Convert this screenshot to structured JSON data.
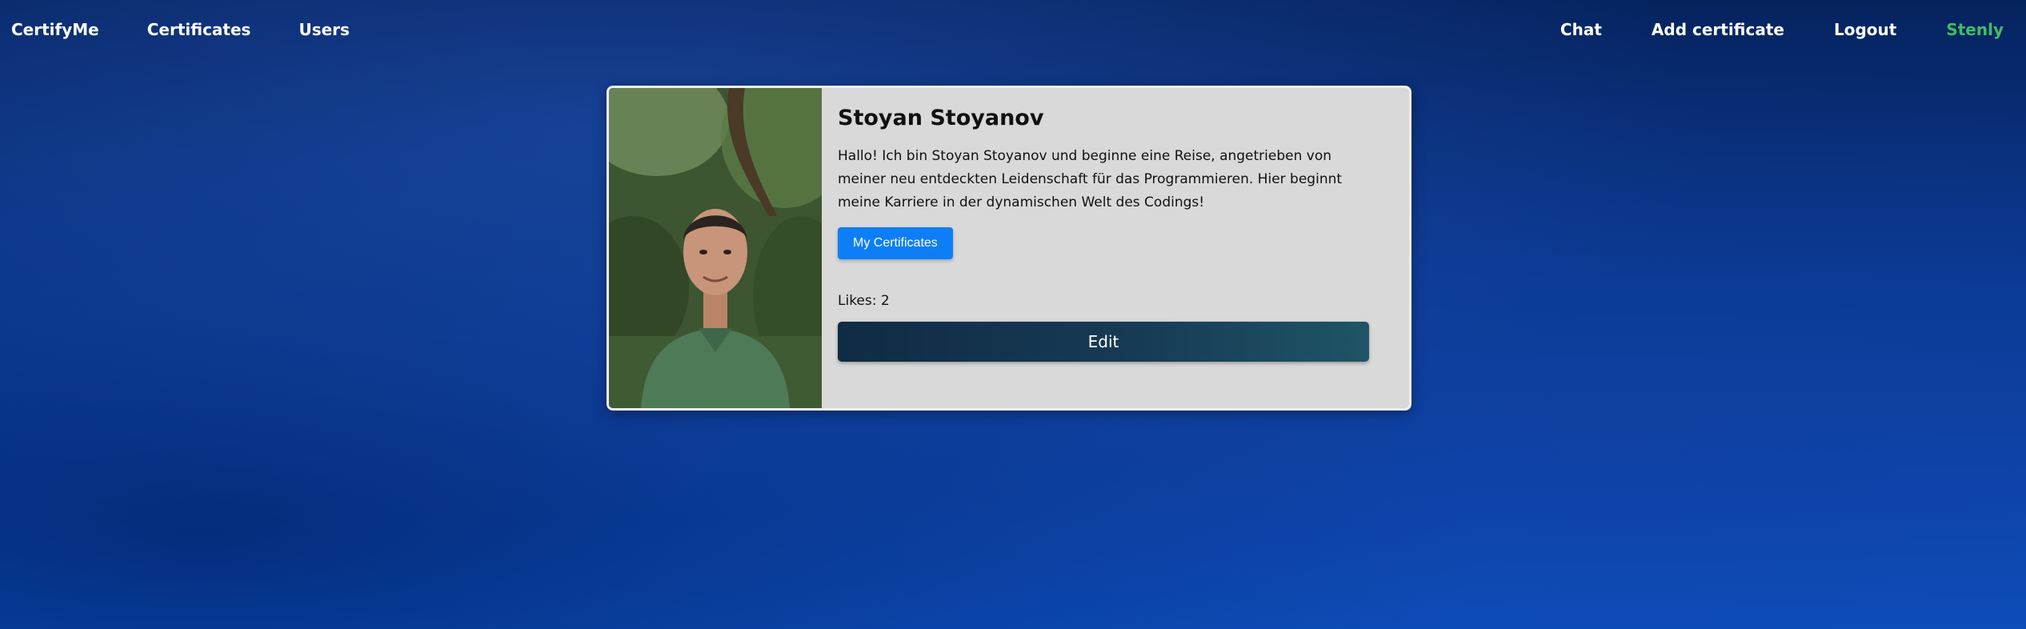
{
  "nav": {
    "brand": "CertifyMe",
    "left": [
      "Certificates",
      "Users"
    ],
    "right": [
      "Chat",
      "Add certificate",
      "Logout"
    ],
    "username": "Stenly"
  },
  "profile": {
    "name": "Stoyan Stoyanov",
    "bio": "Hallo! Ich bin Stoyan Stoyanov und beginne eine Reise, angetrieben von meiner neu entdeckten Leidenschaft für das Programmieren. Hier beginnt meine Karriere in der dynamischen Welt des Codings!",
    "certificates_button": "My Certificates",
    "likes": "Likes: 2",
    "edit_button": "Edit"
  },
  "colors": {
    "username": "#3fbf5f",
    "primary_button": "#0d7ef6",
    "edit_button": "#173a55",
    "card_bg": "#d9d9d9"
  }
}
